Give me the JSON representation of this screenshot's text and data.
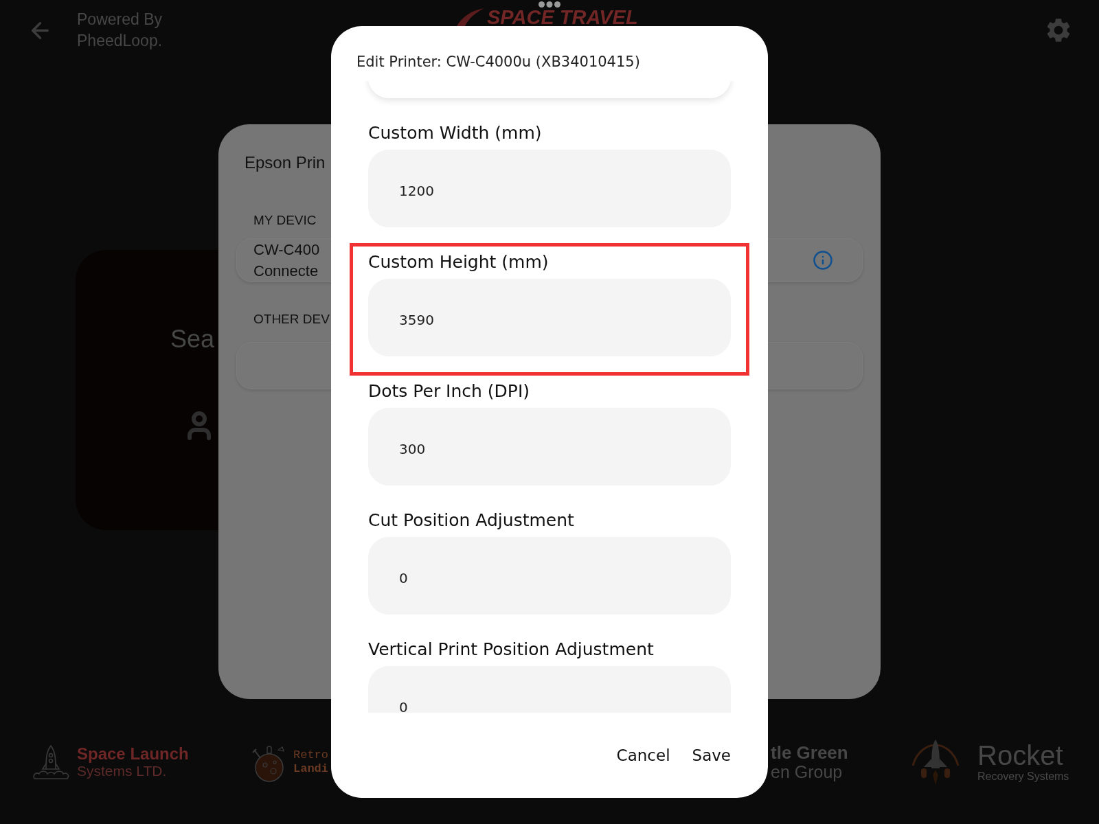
{
  "header": {
    "powered_by": [
      "Powered By",
      "PheedLoop."
    ],
    "logo_text": "SPACE TRAVEL"
  },
  "search_card": {
    "text": "Sea"
  },
  "printer_panel": {
    "title": "Epson Prin",
    "sections": [
      {
        "heading": "MY DEVIC",
        "device": {
          "name": "CW-C400",
          "status": "Connecte",
          "info": true
        }
      },
      {
        "heading": "OTHER DEV"
      }
    ]
  },
  "sponsors": [
    {
      "kind": "launch",
      "name": "Space Launch",
      "subtitle": "Systems LTD."
    },
    {
      "kind": "moon",
      "name": "Retro",
      "subtitle": "Landi"
    },
    {
      "kind": "text",
      "name": "tle Green",
      "subtitle": "en Group"
    },
    {
      "kind": "recovery",
      "name": "Rocket",
      "subtitle": "Recovery Systems"
    }
  ],
  "dialog": {
    "title": "Edit Printer: CW-C4000u (XB34010415)",
    "fields": [
      {
        "label": "Custom Width (mm)",
        "value": "1200",
        "highlighted": false
      },
      {
        "label": "Custom Height (mm)",
        "value": "3590",
        "highlighted": true
      },
      {
        "label": "Dots Per Inch (DPI)",
        "value": "300",
        "highlighted": false
      },
      {
        "label": "Cut Position Adjustment",
        "value": "0",
        "highlighted": false
      },
      {
        "label": "Vertical Print Position Adjustment",
        "value": "0",
        "highlighted": false
      }
    ],
    "buttons": [
      "Cancel",
      "Save"
    ]
  }
}
